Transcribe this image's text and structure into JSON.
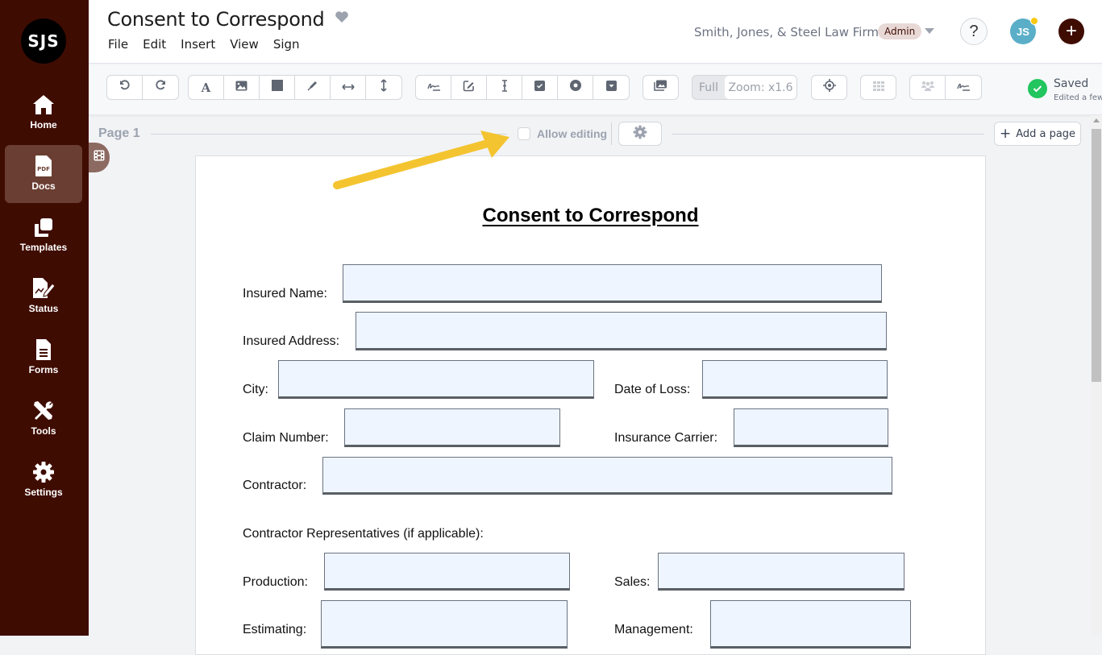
{
  "app": {
    "logo_text": "SJS",
    "document_title": "Consent to Correspond"
  },
  "sidebar": {
    "items": [
      {
        "label": "Home",
        "icon": "home-icon",
        "active": false
      },
      {
        "label": "Docs",
        "icon": "pdf-icon",
        "active": true
      },
      {
        "label": "Templates",
        "icon": "templates-icon",
        "active": false
      },
      {
        "label": "Status",
        "icon": "status-icon",
        "active": false
      },
      {
        "label": "Forms",
        "icon": "forms-icon",
        "active": false
      },
      {
        "label": "Tools",
        "icon": "tools-icon",
        "active": false
      },
      {
        "label": "Settings",
        "icon": "settings-icon",
        "active": false
      }
    ]
  },
  "header": {
    "menu": [
      "File",
      "Edit",
      "Insert",
      "View",
      "Sign"
    ],
    "firm_name": "Smith, Jones, & Steel Law Firm",
    "role_badge": "Admin",
    "help_label": "?",
    "avatar_initials": "JS",
    "add_label": "+"
  },
  "toolbar": {
    "history": [
      "undo-icon",
      "redo-icon"
    ],
    "insert": [
      "text-icon",
      "image-icon",
      "rectangle-icon",
      "pen-icon",
      "horizontal-resize-icon",
      "vertical-resize-icon"
    ],
    "fields": [
      "signature-icon",
      "edit-field-icon",
      "text-cursor-icon",
      "checkbox-icon",
      "radio-icon",
      "dropdown-icon"
    ],
    "zoom_full_label": "Full",
    "zoom_value": "Zoom: x1.6",
    "save_status": "Saved",
    "save_sub": "Edited a few"
  },
  "page_bar": {
    "page_label": "Page 1",
    "allow_editing_label": "Allow editing",
    "allow_editing_checked": false,
    "add_page_label": "Add a page"
  },
  "document": {
    "heading": "Consent to Correspond",
    "labels": {
      "insured_name": "Insured Name:",
      "insured_address": "Insured Address:",
      "city": "City:",
      "date_of_loss": "Date of Loss:",
      "claim_number": "Claim Number:",
      "insurance_carrier": "Insurance Carrier:",
      "contractor": "Contractor:",
      "reps_heading": "Contractor Representatives (if applicable):",
      "production": "Production:",
      "sales": "Sales:",
      "estimating": "Estimating:",
      "management": "Management:"
    }
  },
  "colors": {
    "sidebar_bg": "#3f0c02",
    "accent": "#3f0c02",
    "field_fill": "#eef5ff",
    "saved_green": "#22c55e",
    "annotation_arrow": "#f4c430"
  }
}
